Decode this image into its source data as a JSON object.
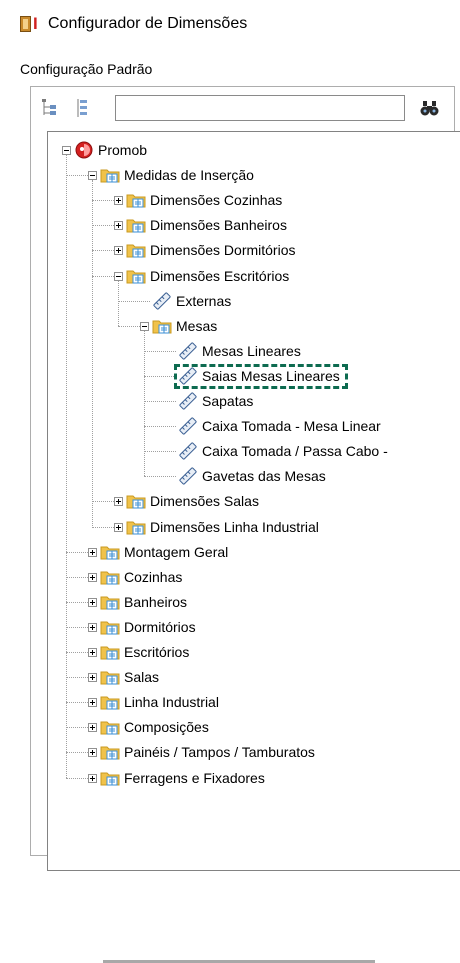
{
  "window": {
    "title": "Configurador de Dimensões"
  },
  "panel": {
    "subtitle": "Configuração Padrão"
  },
  "toolbar": {
    "search_value": "",
    "buttons": [
      "collapse-tree-icon",
      "expand-tree-icon",
      "binoculars-icon"
    ]
  },
  "tree": {
    "root": "Promob",
    "items": [
      {
        "label": "Medidas de Inserção",
        "level": 1,
        "type": "folder",
        "expanded": true
      },
      {
        "label": "Dimensões Cozinhas",
        "level": 2,
        "type": "folder",
        "expanded": false
      },
      {
        "label": "Dimensões Banheiros",
        "level": 2,
        "type": "folder",
        "expanded": false
      },
      {
        "label": "Dimensões Dormitórios",
        "level": 2,
        "type": "folder",
        "expanded": false
      },
      {
        "label": "Dimensões Escritórios",
        "level": 2,
        "type": "folder",
        "expanded": true
      },
      {
        "label": "Externas",
        "level": 3,
        "type": "measure"
      },
      {
        "label": "Mesas",
        "level": 3,
        "type": "folder",
        "expanded": true
      },
      {
        "label": "Mesas Lineares",
        "level": 4,
        "type": "measure"
      },
      {
        "label": "Saias Mesas Lineares",
        "level": 4,
        "type": "measure",
        "selected": true
      },
      {
        "label": "Sapatas",
        "level": 4,
        "type": "measure"
      },
      {
        "label": "Caixa Tomada - Mesa Linear",
        "level": 4,
        "type": "measure"
      },
      {
        "label": "Caixa Tomada / Passa Cabo -",
        "level": 4,
        "type": "measure"
      },
      {
        "label": "Gavetas das Mesas",
        "level": 4,
        "type": "measure"
      },
      {
        "label": "Dimensões Salas",
        "level": 2,
        "type": "folder",
        "expanded": false
      },
      {
        "label": "Dimensões Linha Industrial",
        "level": 2,
        "type": "folder",
        "expanded": false
      },
      {
        "label": "Montagem Geral",
        "level": 1,
        "type": "folder",
        "expanded": false
      },
      {
        "label": "Cozinhas",
        "level": 1,
        "type": "folder",
        "expanded": false
      },
      {
        "label": "Banheiros",
        "level": 1,
        "type": "folder",
        "expanded": false
      },
      {
        "label": "Dormitórios",
        "level": 1,
        "type": "folder",
        "expanded": false
      },
      {
        "label": "Escritórios",
        "level": 1,
        "type": "folder",
        "expanded": false
      },
      {
        "label": "Salas",
        "level": 1,
        "type": "folder",
        "expanded": false
      },
      {
        "label": "Linha Industrial",
        "level": 1,
        "type": "folder",
        "expanded": false
      },
      {
        "label": "Composições",
        "level": 1,
        "type": "folder",
        "expanded": false
      },
      {
        "label": "Painéis / Tampos / Tamburatos",
        "level": 1,
        "type": "folder",
        "expanded": false
      },
      {
        "label": "Ferragens e Fixadores",
        "level": 1,
        "type": "folder",
        "expanded": false
      }
    ]
  },
  "colors": {
    "highlight": "#0d6b50",
    "folder": "#f0c24a",
    "folder_doc": "#3b8fd6",
    "root_icon": "#d42020"
  }
}
